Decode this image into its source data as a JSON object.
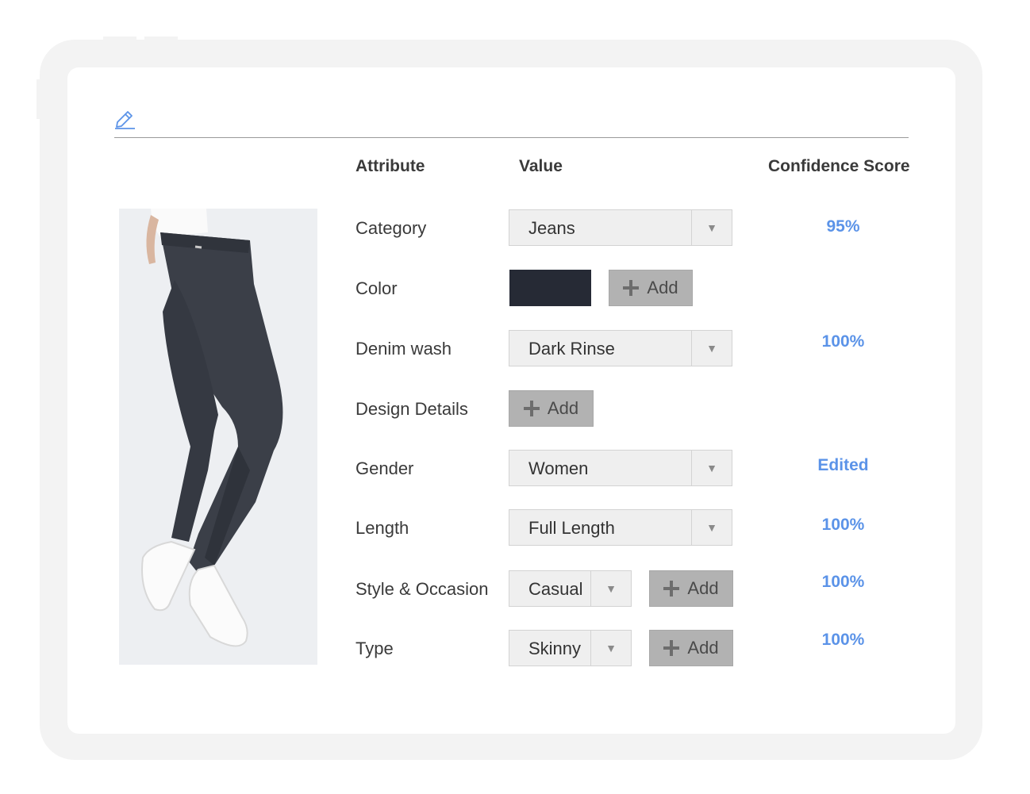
{
  "table": {
    "headers": {
      "attribute": "Attribute",
      "value": "Value",
      "confidence": "Confidence Score"
    },
    "rows": [
      {
        "attribute": "Category",
        "value": "Jeans",
        "confidence": "95%"
      },
      {
        "attribute": "Color",
        "value_color": "#262a35",
        "add_label": "Add",
        "confidence": ""
      },
      {
        "attribute": "Denim wash",
        "value": "Dark Rinse",
        "confidence": "100%"
      },
      {
        "attribute": "Design Details",
        "add_label": "Add",
        "confidence": ""
      },
      {
        "attribute": "Gender",
        "value": "Women",
        "confidence": "Edited"
      },
      {
        "attribute": "Length",
        "value": "Full Length",
        "confidence": "100%"
      },
      {
        "attribute": "Style & Occasion",
        "value": "Casual",
        "add_label": "Add",
        "confidence": "100%"
      },
      {
        "attribute": "Type",
        "value": "Skinny",
        "add_label": "Add",
        "confidence": "100%"
      }
    ]
  },
  "icons": {
    "edit": "pencil-edit-icon",
    "dropdown": "triangle-down-icon",
    "add": "plus-icon"
  },
  "colors": {
    "accent": "#5b93e8",
    "add_button": "#b2b2b2",
    "swatch": "#262a35",
    "frame": "#f3f3f3"
  }
}
